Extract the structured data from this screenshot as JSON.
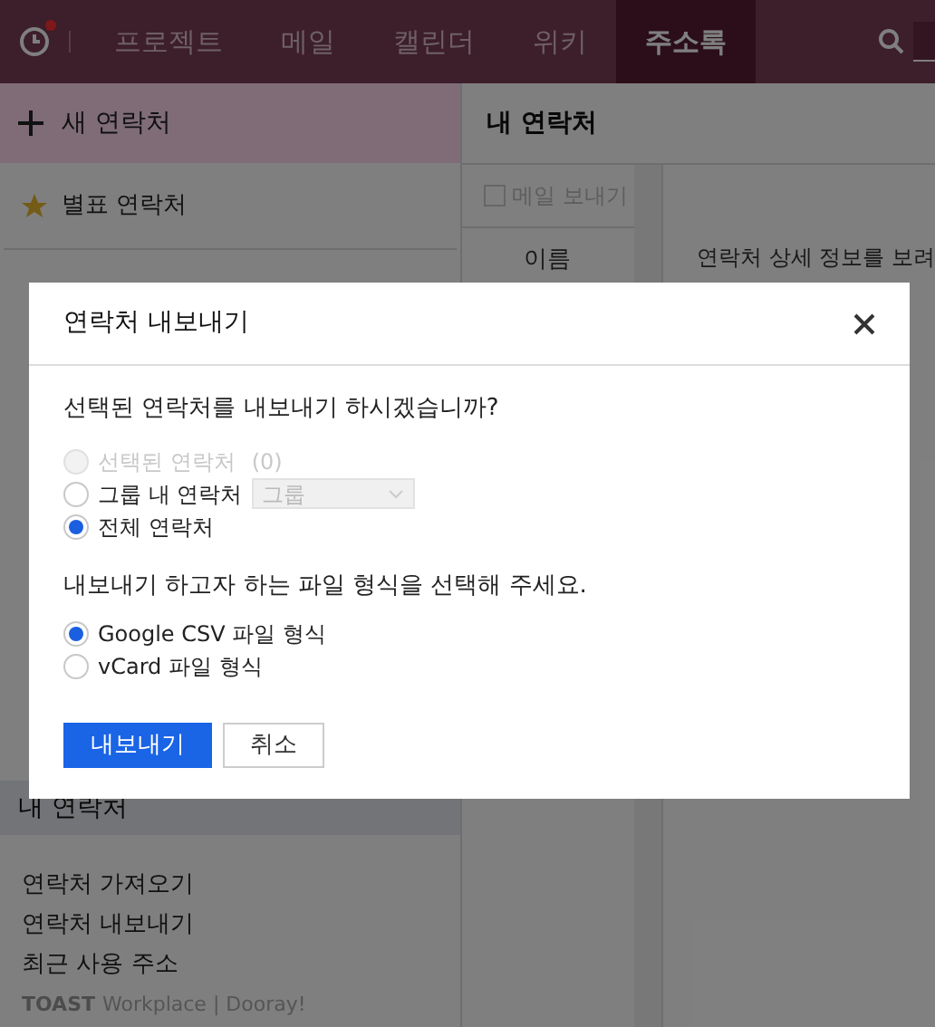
{
  "nav": {
    "tabs": [
      {
        "label": "프로젝트",
        "selected": false
      },
      {
        "label": "메일",
        "selected": false
      },
      {
        "label": "캘린더",
        "selected": false
      },
      {
        "label": "위키",
        "selected": false
      },
      {
        "label": "주소록",
        "selected": true
      }
    ],
    "notification": true
  },
  "sidebar": {
    "new_contact": "새 연락처",
    "starred": "별표 연락처",
    "group_header": "내 연락처",
    "links": [
      "연락처 가져오기",
      "연락처 내보내기",
      "최근 사용 주소"
    ],
    "logo": {
      "brand": "TOAST",
      "product": "Workplace | Dooray!"
    }
  },
  "list": {
    "title": "내 연락처",
    "send_mail": "메일 보내기",
    "select_all": false,
    "column": "이름"
  },
  "detail": {
    "hint": "연락처 상세 정보를 보려"
  },
  "dialog": {
    "title": "연락처 내보내기",
    "question": "선택된 연락처를 내보내기 하시겠습니까?",
    "scope_options": [
      {
        "label": "선택된 연락처",
        "count": "(0)",
        "selected": false,
        "disabled": true
      },
      {
        "label": "그룹 내 연락처",
        "select": "그룹",
        "selected": false,
        "disabled": false
      },
      {
        "label": "전체 연락처",
        "selected": true,
        "disabled": false
      }
    ],
    "format_prompt": "내보내기 하고자 하는 파일 형식을 선택해 주세요.",
    "format_options": [
      {
        "label": "Google CSV 파일 형식",
        "selected": true
      },
      {
        "label": "vCard 파일 형식",
        "selected": false
      }
    ],
    "buttons": [
      {
        "label": "내보내기",
        "kind": "primary"
      },
      {
        "label": "취소",
        "kind": "secondary"
      }
    ]
  }
}
